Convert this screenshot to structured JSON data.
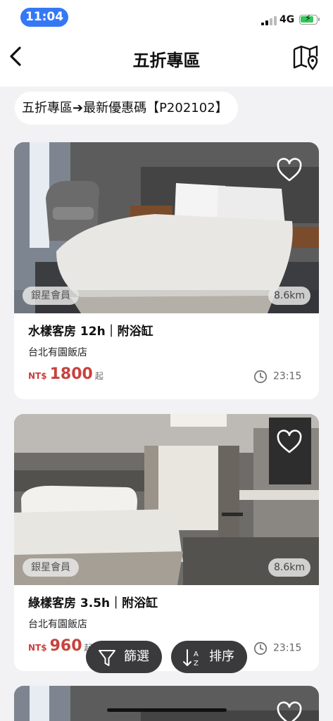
{
  "status_bar": {
    "time": "11:04",
    "network": "4G"
  },
  "header": {
    "title": "五折專區"
  },
  "breadcrumb": {
    "text": "五折專區➔最新優惠碼【P202102】"
  },
  "rooms": [
    {
      "member_badge": "銀星會員",
      "distance": "8.6km",
      "name": "水樣客房 12h｜附浴缸",
      "hotel": "台北有園飯店",
      "currency": "NT$",
      "price": "1800",
      "price_suffix": "起",
      "time": "23:15"
    },
    {
      "member_badge": "銀星會員",
      "distance": "8.6km",
      "name": "綠樣客房 3.5h｜附浴缸",
      "hotel": "台北有園飯店",
      "currency": "NT$",
      "price": "960",
      "price_suffix": "起",
      "time": "23:15"
    }
  ],
  "actions": {
    "filter_label": "篩選",
    "sort_label": "排序"
  },
  "colors": {
    "accent_price": "#c9413d",
    "status_pill": "#3478f6",
    "floating_button": "#3a3a3c"
  },
  "icons": {
    "back": "chevron-left-icon",
    "map": "map-pin-icon",
    "favorite": "heart-icon",
    "clock": "clock-icon",
    "filter": "funnel-icon",
    "sort": "sort-az-icon"
  }
}
